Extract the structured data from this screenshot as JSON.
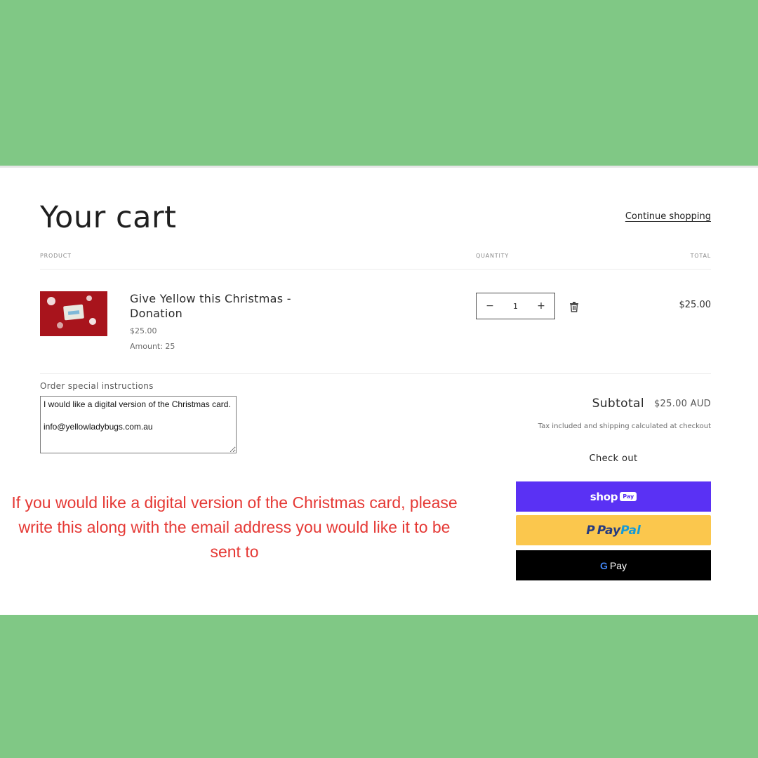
{
  "cart": {
    "title": "Your cart",
    "continue_link": "Continue shopping",
    "columns": {
      "product": "PRODUCT",
      "quantity": "QUANTITY",
      "total": "TOTAL"
    },
    "item": {
      "name": "Give Yellow this Christmas - Donation",
      "price": "$25.00",
      "amount": "Amount: 25",
      "quantity": "1",
      "minus": "−",
      "plus": "+",
      "line_total": "$25.00"
    }
  },
  "instructions": {
    "label": "Order special instructions",
    "value": "I would like a digital version of the Christmas card.\n\ninfo@yellowladybugs.com.au"
  },
  "summary": {
    "subtotal_label": "Subtotal",
    "subtotal_value": "$25.00 AUD",
    "tax_note": "Tax included and shipping calculated at checkout",
    "checkout_label": "Check out"
  },
  "payments": {
    "shop": {
      "text": "shop",
      "badge": "Pay"
    },
    "paypal": {
      "p": "P",
      "pay": "Pay",
      "pal": "Pal"
    },
    "gpay": {
      "g": "G",
      "pay": "Pay"
    }
  },
  "note": "If you would like a digital version of the Christmas card, please write this along with the email address you would like it to be sent to",
  "colors": {
    "background": "#80c885",
    "note_text": "#e53935",
    "shop_pay": "#5a31f4",
    "paypal": "#fbc74d",
    "gpay": "#000000",
    "thumbnail": "#a8141c"
  },
  "icons": {
    "delete": "trash-icon"
  }
}
